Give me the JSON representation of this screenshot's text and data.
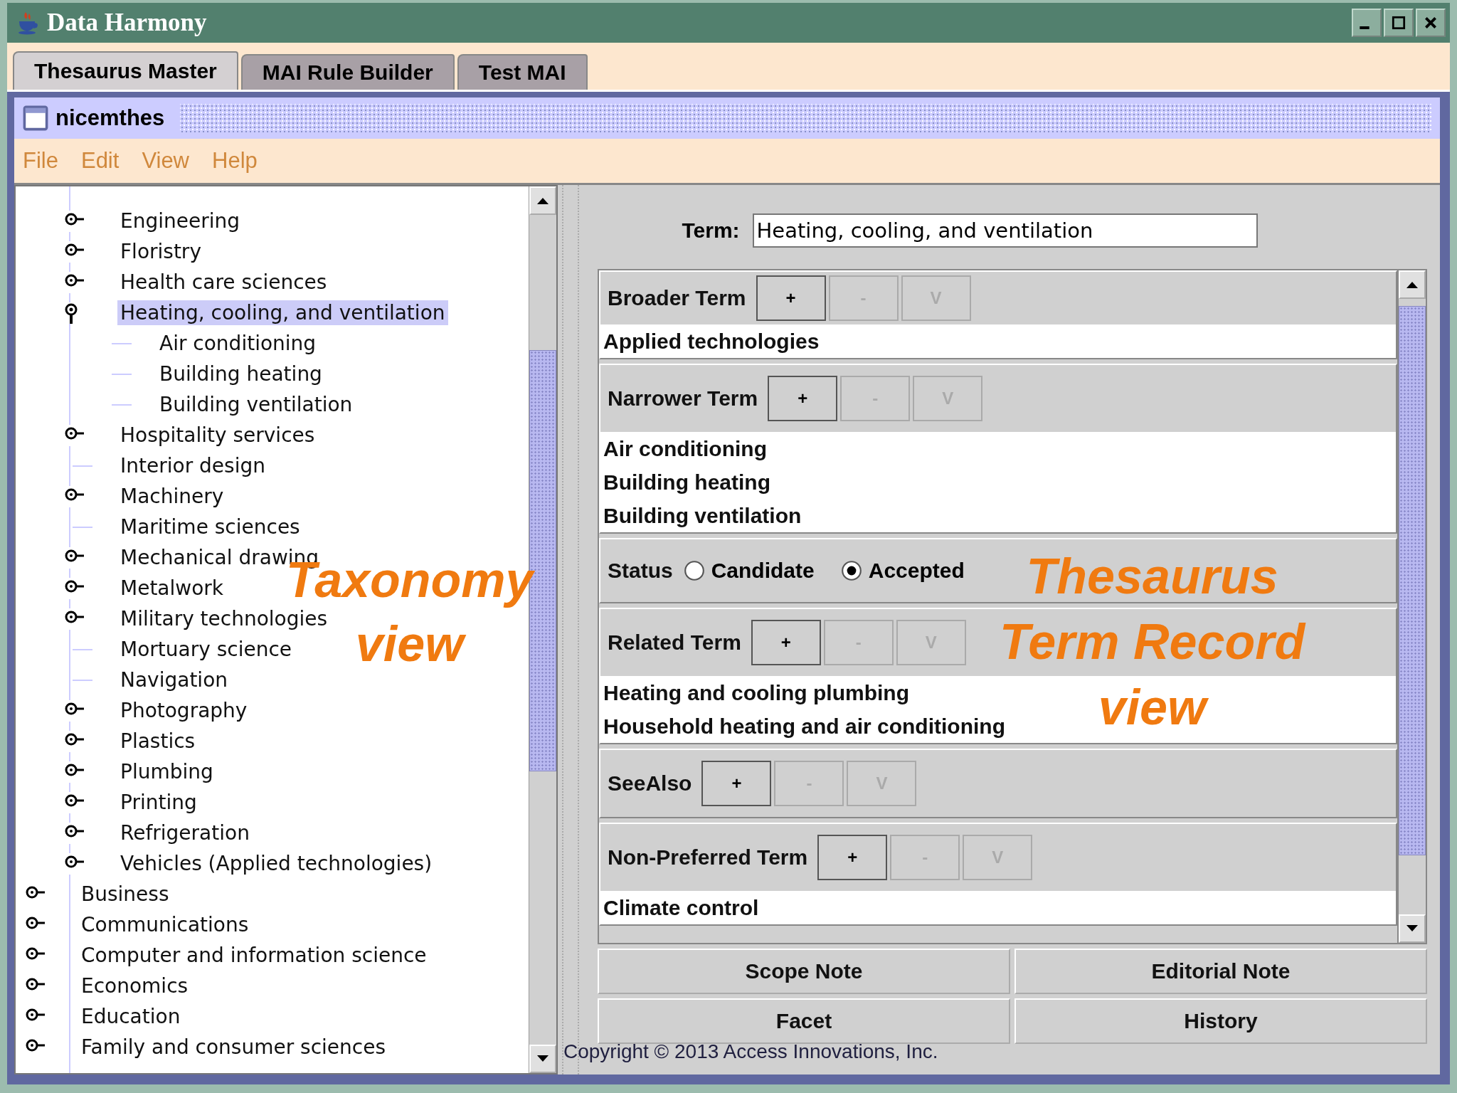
{
  "window": {
    "title": "Data Harmony"
  },
  "tabs": [
    {
      "label": "Thesaurus Master",
      "selected": true
    },
    {
      "label": "MAI Rule Builder",
      "selected": false
    },
    {
      "label": "Test MAI",
      "selected": false
    }
  ],
  "frame": {
    "title": "nicemthes"
  },
  "menu": [
    "File",
    "Edit",
    "View",
    "Help"
  ],
  "tree": {
    "open_branch": [
      {
        "label": "Engineering",
        "kind": "branch",
        "expanded": false,
        "selected": false
      },
      {
        "label": "Floristry",
        "kind": "branch",
        "expanded": false,
        "selected": false
      },
      {
        "label": "Health care sciences",
        "kind": "branch",
        "expanded": false,
        "selected": false
      },
      {
        "label": "Heating, cooling, and ventilation",
        "kind": "branch",
        "expanded": true,
        "selected": true,
        "children": [
          {
            "label": "Air conditioning",
            "kind": "leaf",
            "selected": false
          },
          {
            "label": "Building heating",
            "kind": "leaf",
            "selected": false
          },
          {
            "label": "Building ventilation",
            "kind": "leaf",
            "selected": false
          }
        ]
      },
      {
        "label": "Hospitality services",
        "kind": "branch",
        "expanded": false,
        "selected": false
      },
      {
        "label": "Interior design",
        "kind": "leaf",
        "selected": false
      },
      {
        "label": "Machinery",
        "kind": "branch",
        "expanded": false,
        "selected": false
      },
      {
        "label": "Maritime sciences",
        "kind": "leaf",
        "selected": false
      },
      {
        "label": "Mechanical drawing",
        "kind": "branch",
        "expanded": false,
        "selected": false
      },
      {
        "label": "Metalwork",
        "kind": "branch",
        "expanded": false,
        "selected": false
      },
      {
        "label": "Military technologies",
        "kind": "branch",
        "expanded": false,
        "selected": false
      },
      {
        "label": "Mortuary science",
        "kind": "leaf",
        "selected": false
      },
      {
        "label": "Navigation",
        "kind": "leaf",
        "selected": false
      },
      {
        "label": "Photography",
        "kind": "branch",
        "expanded": false,
        "selected": false
      },
      {
        "label": "Plastics",
        "kind": "branch",
        "expanded": false,
        "selected": false
      },
      {
        "label": "Plumbing",
        "kind": "branch",
        "expanded": false,
        "selected": false
      },
      {
        "label": "Printing",
        "kind": "branch",
        "expanded": false,
        "selected": false
      },
      {
        "label": "Refrigeration",
        "kind": "branch",
        "expanded": false,
        "selected": false
      },
      {
        "label": "Vehicles (Applied technologies)",
        "kind": "branch",
        "expanded": false,
        "selected": false
      }
    ],
    "top_level": [
      {
        "label": "Business",
        "kind": "branch",
        "expanded": false,
        "selected": false
      },
      {
        "label": "Communications",
        "kind": "branch",
        "expanded": false,
        "selected": false
      },
      {
        "label": "Computer and information science",
        "kind": "branch",
        "expanded": false,
        "selected": false
      },
      {
        "label": "Economics",
        "kind": "branch",
        "expanded": false,
        "selected": false
      },
      {
        "label": "Education",
        "kind": "branch",
        "expanded": false,
        "selected": false
      },
      {
        "label": "Family and consumer sciences",
        "kind": "branch",
        "expanded": false,
        "selected": false
      }
    ]
  },
  "term": {
    "label": "Term:",
    "value": "Heating, cooling, and ventilation"
  },
  "sections": [
    {
      "kind": "terms",
      "label": "Broader Term",
      "buttons": [
        {
          "label": "+",
          "disabled": false
        },
        {
          "label": "-",
          "disabled": true
        },
        {
          "label": "V",
          "disabled": true
        }
      ],
      "items": [
        "Applied technologies"
      ]
    },
    {
      "kind": "terms",
      "label": "Narrower Term",
      "buttons": [
        {
          "label": "+",
          "disabled": false
        },
        {
          "label": "-",
          "disabled": true
        },
        {
          "label": "V",
          "disabled": true
        }
      ],
      "items": [
        "Air conditioning",
        "Building heating",
        "Building ventilation"
      ]
    },
    {
      "kind": "status",
      "label": "Status",
      "options": [
        {
          "label": "Candidate",
          "selected": false
        },
        {
          "label": "Accepted",
          "selected": true
        }
      ]
    },
    {
      "kind": "terms",
      "label": "Related Term",
      "buttons": [
        {
          "label": "+",
          "disabled": false
        },
        {
          "label": "-",
          "disabled": true
        },
        {
          "label": "V",
          "disabled": true
        }
      ],
      "items": [
        "Heating and cooling plumbing",
        "Household heating and air conditioning"
      ]
    },
    {
      "kind": "terms",
      "label": "SeeAlso",
      "buttons": [
        {
          "label": "+",
          "disabled": false
        },
        {
          "label": "-",
          "disabled": true
        },
        {
          "label": "V",
          "disabled": true
        }
      ]
    },
    {
      "kind": "terms",
      "label": "Non-Preferred Term",
      "buttons": [
        {
          "label": "+",
          "disabled": false
        },
        {
          "label": "-",
          "disabled": true
        },
        {
          "label": "V",
          "disabled": true
        }
      ],
      "items": [
        "Climate control"
      ]
    }
  ],
  "note_buttons": [
    "Scope Note",
    "Editorial Note",
    "Facet",
    "History"
  ],
  "annotations": [
    {
      "lines": [
        "Taxonomy",
        "view"
      ]
    },
    {
      "lines": [
        "Thesaurus",
        "Term Record",
        "view"
      ]
    }
  ],
  "copyright": "Copyright © 2013 Access Innovations, Inc."
}
